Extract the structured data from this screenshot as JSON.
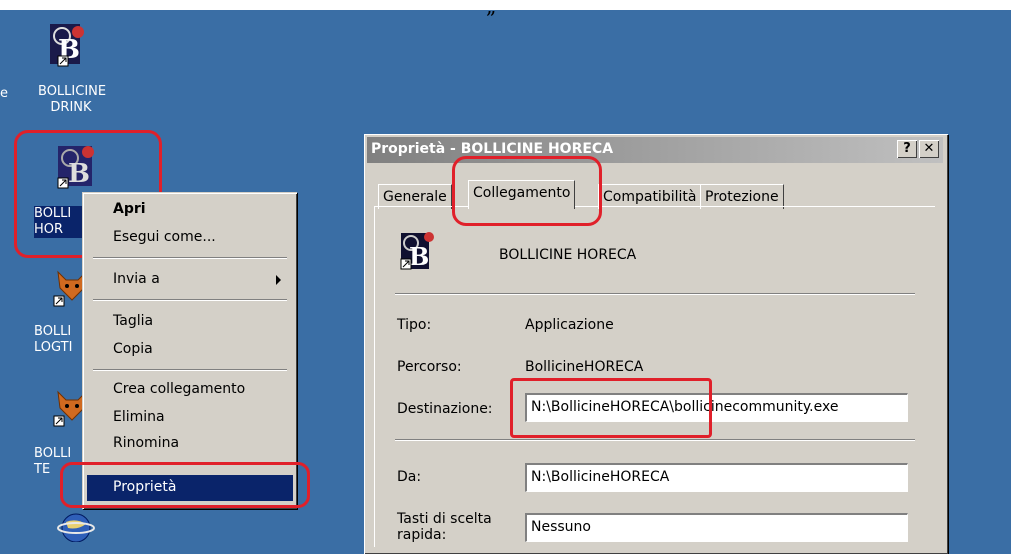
{
  "desktop": {
    "top_quote": "„",
    "edge_letter": "e",
    "icons": [
      {
        "label": "BOLLICINE\nDRINK",
        "icon": "bollicine-app-icon"
      },
      {
        "label": "BOLLI\nHOR",
        "icon": "bollicine-app-icon"
      },
      {
        "label": "BOLLI\nLOGTI",
        "icon": "fox-app-icon"
      },
      {
        "label": "BOLLI\nTE",
        "icon": "fox-app-icon"
      },
      {
        "label": "",
        "icon": "globe-icon"
      }
    ]
  },
  "context_menu": {
    "items": [
      {
        "label": "Apri",
        "bold": true
      },
      {
        "label": "Esegui come..."
      },
      {
        "label": "Invia a",
        "submenu": true
      },
      {
        "label": "Taglia"
      },
      {
        "label": "Copia"
      },
      {
        "label": "Crea collegamento"
      },
      {
        "label": "Elimina"
      },
      {
        "label": "Rinomina"
      },
      {
        "label": "Proprietà",
        "highlighted": true
      }
    ]
  },
  "dialog": {
    "title": "Proprietà - BOLLICINE HORECA",
    "help_button": "?",
    "close_button": "✕",
    "tabs": [
      "Generale",
      "Collegamento",
      "Compatibilità",
      "Protezione"
    ],
    "active_tab": "Collegamento",
    "shortcut_name": "BOLLICINE HORECA",
    "fields": {
      "tipo_label": "Tipo:",
      "tipo_value": "Applicazione",
      "percorso_label": "Percorso:",
      "percorso_value": "BollicineHORECA",
      "destinazione_label": "Destinazione:",
      "destinazione_value": "N:\\BollicineHORECA\\bollicinecommunity.exe",
      "da_label": "Da:",
      "da_value": "N:\\BollicineHORECA",
      "tasti_label_1": "Tasti di scelta",
      "tasti_label_2": "rapida:",
      "tasti_value": "Nessuno"
    }
  },
  "colors": {
    "desktop": "#3a6ea5",
    "menu_highlight": "#0a246a",
    "annotation_red": "#e0202a",
    "window_face": "#d4d0c8"
  }
}
